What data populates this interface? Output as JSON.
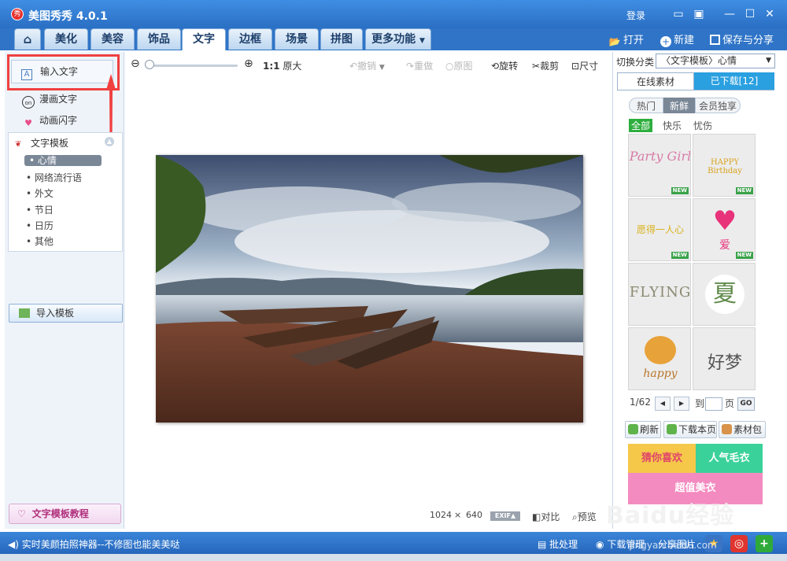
{
  "titlebar": {
    "logo_text": "秀",
    "title": "美图秀秀 4.0.1",
    "login": "登录",
    "buttons": [
      "feedback",
      "skin",
      "minimize",
      "maximize",
      "close"
    ]
  },
  "tabs": [
    {
      "label": "",
      "icon": "home-icon"
    },
    {
      "label": "美化"
    },
    {
      "label": "美容"
    },
    {
      "label": "饰品"
    },
    {
      "label": "文字",
      "active": true
    },
    {
      "label": "边框"
    },
    {
      "label": "场景"
    },
    {
      "label": "拼图"
    },
    {
      "label": "更多功能"
    }
  ],
  "header_actions": {
    "open": "打开",
    "new": "新建",
    "save_share": "保存与分享"
  },
  "left_panel": {
    "input_text": "输入文字",
    "input_text_icon": "A",
    "comic_text": "漫画文字",
    "animated_text": "动画闪字",
    "template_header": "文字模板",
    "template_items": [
      "心情",
      "网络流行语",
      "外文",
      "节日",
      "日历",
      "其他"
    ],
    "selected_template": "心情",
    "import_template": "导入模板",
    "tutorial": "文字模板教程"
  },
  "toolbar": {
    "actual_size_prefix": "1:1",
    "actual_size": "原大",
    "undo": "撤销",
    "redo": "重做",
    "original": "原图",
    "rotate": "旋转",
    "crop": "裁剪",
    "resize": "尺寸"
  },
  "image_info": {
    "width": "1024",
    "times": "×",
    "height": "640",
    "exif": "EXIF▲",
    "compare": "对比",
    "preview": "预览"
  },
  "right_panel": {
    "switch_label": "切换分类",
    "switch_value": "〈文字模板〉心情",
    "sub_tabs": {
      "online": "在线素材",
      "downloaded": "已下载[12]"
    },
    "categories": [
      {
        "label": "热门"
      },
      {
        "label": "新鲜",
        "active": true
      },
      {
        "label": "会员独享"
      }
    ],
    "moods": [
      {
        "label": "全部",
        "active": true
      },
      {
        "label": "快乐"
      },
      {
        "label": "忧伤"
      }
    ],
    "thumbnails": [
      {
        "text": "Party Girl",
        "new": true
      },
      {
        "text": "HAPPY Birthday",
        "new": true
      },
      {
        "text": "愿得一人心",
        "new": true
      },
      {
        "text": "爱",
        "new": true
      },
      {
        "text": "FLYING",
        "new": false
      },
      {
        "text": "夏",
        "new": false
      },
      {
        "text": "happy",
        "new": false
      },
      {
        "text": "好梦",
        "new": false
      }
    ],
    "new_tag": "NEW",
    "pager": {
      "current": "1/62",
      "goto": "到",
      "page": "页",
      "go": "GO"
    },
    "actions": {
      "refresh": "刷新",
      "download_page": "下载本页",
      "material_pack": "素材包"
    },
    "banners": [
      "猜你喜欢",
      "人气毛衣",
      "超值美衣"
    ]
  },
  "statusbar": {
    "message": "实时美颜拍照神器--不修图也能美美哒",
    "batch": "批处理",
    "download_mgr": "下载管理",
    "share": "分享图片"
  },
  "watermark": {
    "brand": "Baidu经验",
    "url": "jingyan.baidu.com"
  },
  "colors": {
    "titlebar_blue": "#2f74c7",
    "highlight_red": "#f04040",
    "downloaded_tab": "#2aa0e0",
    "new_green": "#3aa24a"
  }
}
